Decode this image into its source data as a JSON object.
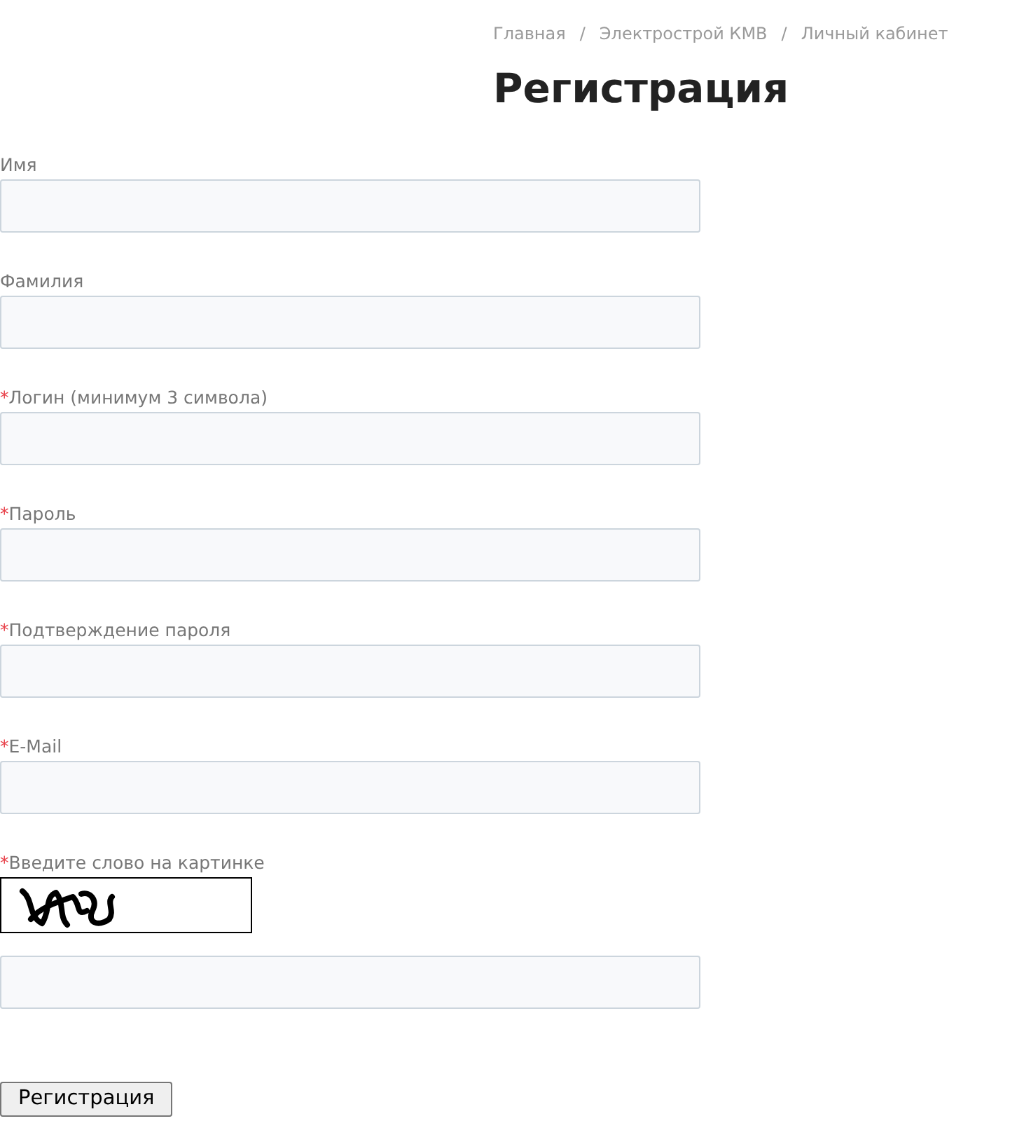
{
  "breadcrumbs": [
    {
      "label": "Главная",
      "separator": "/"
    },
    {
      "label": "Электрострой КМВ",
      "separator": "/"
    },
    {
      "label": "Личный кабинет"
    }
  ],
  "title": "Регистрация",
  "form": {
    "fields": [
      {
        "label": "Имя"
      },
      {
        "label": "Фамилия"
      },
      {
        "label": "Логин (минимум 3 символа)",
        "required_mark": "*"
      },
      {
        "label": "Пароль",
        "required_mark": "*"
      },
      {
        "label": "Подтверждение пароля",
        "required_mark": "*"
      },
      {
        "label": "E-Mail",
        "required_mark": "*"
      }
    ],
    "captcha": {
      "label": "Введите слово на картинке",
      "required_mark": "*"
    },
    "submit_button": {
      "label": "Регистрация"
    }
  }
}
